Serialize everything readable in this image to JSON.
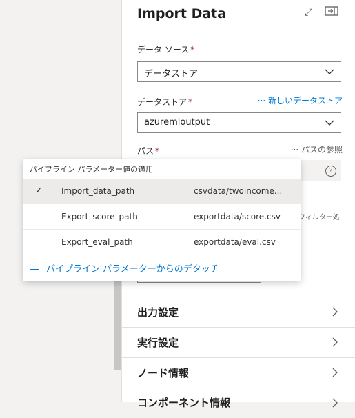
{
  "panel": {
    "title": "Import Data",
    "data_source_label": "データ ソース",
    "data_source_value": "データストア",
    "datastore_label": "データストア",
    "new_datastore_link": "新しいデータストア",
    "datastore_value": "azuremloutput",
    "path_label": "パス",
    "browse_path_link": "パスの参照",
    "filter_partial": "フィルター処",
    "required_mark": "*",
    "help_icon_glyph": "?"
  },
  "sections": [
    {
      "title": "出力設定"
    },
    {
      "title": "実行設定"
    },
    {
      "title": "ノード情報"
    },
    {
      "title": "コンポーネント情報"
    }
  ],
  "popup": {
    "header": "パイプライン パラメーター値の適用",
    "rows": [
      {
        "name": "Import_data_path",
        "value": "csvdata/twoincome...",
        "selected": true
      },
      {
        "name": "Export_score_path",
        "value": "exportdata/score.csv",
        "selected": false
      },
      {
        "name": "Export_eval_path",
        "value": "exportdata/eval.csv",
        "selected": false
      }
    ],
    "detach_label": "パイプライン パラメーターからのデタッチ"
  },
  "icons": [
    "expand-icon",
    "dock-icon",
    "chevron-down-icon",
    "chevron-right-icon",
    "checkmark-icon",
    "help-icon",
    "more-icon"
  ],
  "colors": {
    "accent": "#0078d4",
    "required": "#a4262c",
    "selected_row": "#edebe9"
  }
}
